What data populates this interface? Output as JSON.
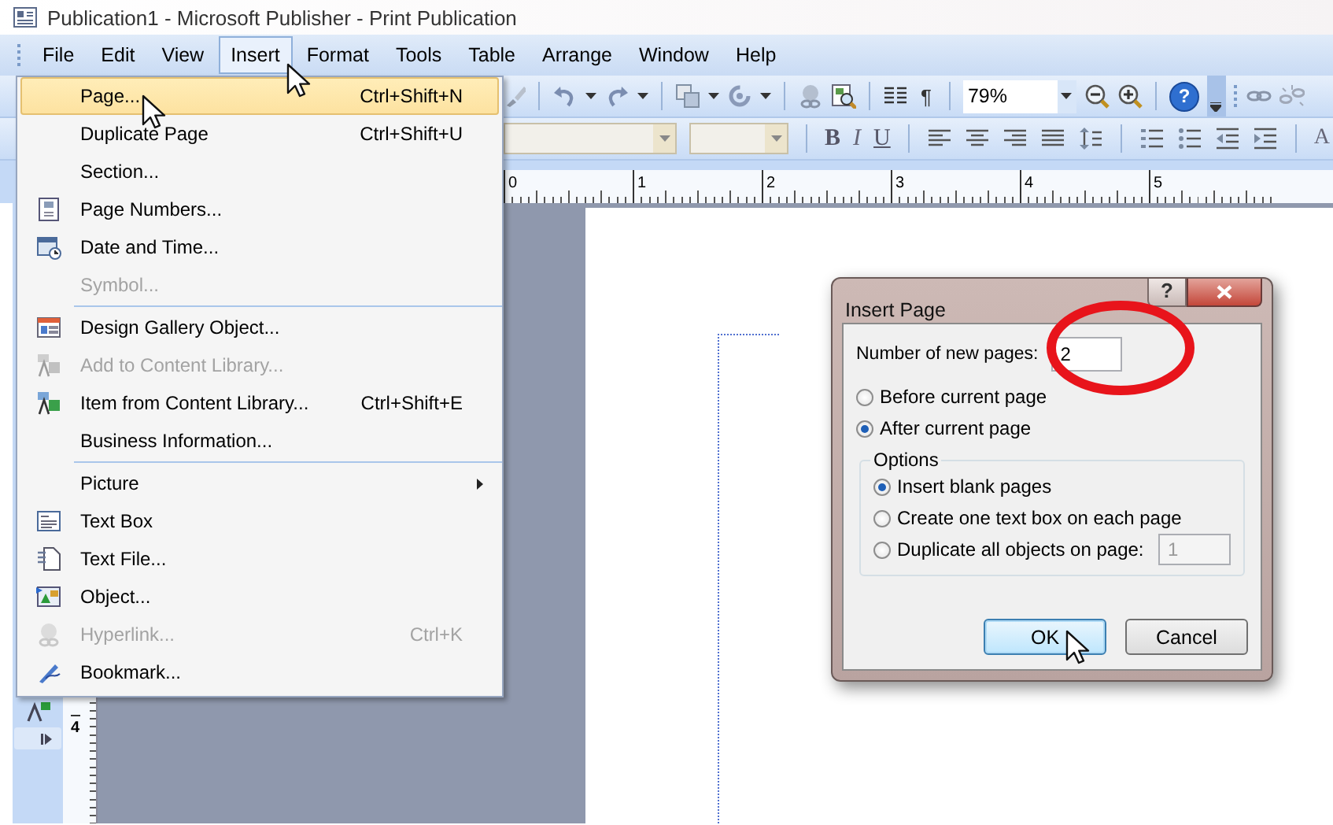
{
  "window": {
    "title": "Publication1 - Microsoft Publisher - Print Publication"
  },
  "menu_bar": [
    {
      "label": "File",
      "selected": false
    },
    {
      "label": "Edit",
      "selected": false
    },
    {
      "label": "View",
      "selected": false
    },
    {
      "label": "Insert",
      "selected": true
    },
    {
      "label": "Format",
      "selected": false
    },
    {
      "label": "Tools",
      "selected": false
    },
    {
      "label": "Table",
      "selected": false
    },
    {
      "label": "Arrange",
      "selected": false
    },
    {
      "label": "Window",
      "selected": false
    },
    {
      "label": "Help",
      "selected": false
    }
  ],
  "standard_toolbar": {
    "show_marks": "¶",
    "zoom": "79%",
    "help": "?"
  },
  "formatting_toolbar": {
    "bold": "B",
    "italic": "I",
    "underline": "U",
    "grow_font": "A"
  },
  "ruler": {
    "horizontal": [
      "0",
      "1",
      "2",
      "3",
      "4",
      "5"
    ],
    "vertical": [
      "4"
    ]
  },
  "insert_menu": [
    {
      "kind": "item",
      "label": "Page...",
      "shortcut": "Ctrl+Shift+N",
      "selected": true,
      "disabled": false
    },
    {
      "kind": "item",
      "label": "Duplicate Page",
      "shortcut": "Ctrl+Shift+U",
      "selected": false,
      "disabled": false
    },
    {
      "kind": "item",
      "label": "Section...",
      "selected": false,
      "disabled": false
    },
    {
      "kind": "item",
      "label": "Page Numbers...",
      "selected": false,
      "disabled": false
    },
    {
      "kind": "item",
      "label": "Date and Time...",
      "selected": false,
      "disabled": false
    },
    {
      "kind": "item",
      "label": "Symbol...",
      "selected": false,
      "disabled": true
    },
    {
      "kind": "separator"
    },
    {
      "kind": "item",
      "label": "Design Gallery Object...",
      "selected": false,
      "disabled": false
    },
    {
      "kind": "item",
      "label": "Add to Content Library...",
      "selected": false,
      "disabled": true
    },
    {
      "kind": "item",
      "label": "Item from Content Library...",
      "shortcut": "Ctrl+Shift+E",
      "selected": false,
      "disabled": false
    },
    {
      "kind": "item",
      "label": "Business Information...",
      "selected": false,
      "disabled": false
    },
    {
      "kind": "separator"
    },
    {
      "kind": "submenu",
      "label": "Picture",
      "selected": false,
      "disabled": false
    },
    {
      "kind": "item",
      "label": "Text Box",
      "selected": false,
      "disabled": false
    },
    {
      "kind": "item",
      "label": "Text File...",
      "selected": false,
      "disabled": false
    },
    {
      "kind": "item",
      "label": "Object...",
      "selected": false,
      "disabled": false
    },
    {
      "kind": "item",
      "label": "Hyperlink...",
      "shortcut": "Ctrl+K",
      "selected": false,
      "disabled": true
    },
    {
      "kind": "item",
      "label": "Bookmark...",
      "selected": false,
      "disabled": false
    }
  ],
  "dialog": {
    "title": "Insert Page",
    "help_button": "?",
    "number_label": "Number of new pages:",
    "number_value": "2",
    "position": [
      {
        "label": "Before current page",
        "selected": false
      },
      {
        "label": "After current page",
        "selected": true
      }
    ],
    "options_title": "Options",
    "options": [
      {
        "label": "Insert blank pages",
        "selected": true
      },
      {
        "label": "Create one text box on each page",
        "selected": false
      },
      {
        "label": "Duplicate all objects on page:",
        "selected": false
      }
    ],
    "duplicate_value": "1",
    "duplicate_disabled": true,
    "buttons": [
      {
        "label": "OK",
        "default": true
      },
      {
        "label": "Cancel",
        "default": false
      }
    ]
  }
}
